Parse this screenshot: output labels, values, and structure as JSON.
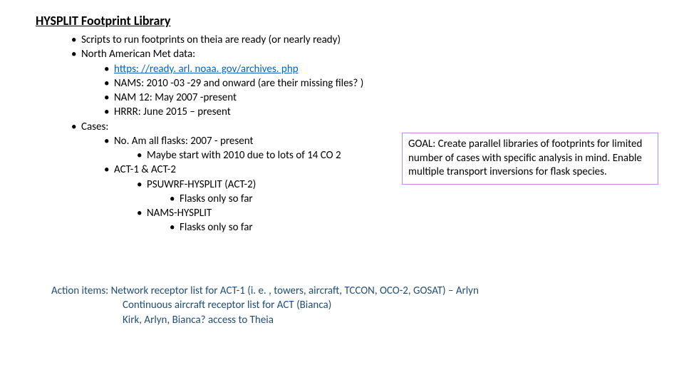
{
  "title": "HYSPLIT Footprint Library",
  "bullets": {
    "b1": "Scripts to run footprints on theia are ready (or nearly ready)",
    "b2": "North American Met data:",
    "b2a_url": "https: //ready. arl. noaa. gov/archives. php",
    "b2b": "NAMS: 2010 -03 -29 and onward (are their missing files? )",
    "b2c": "NAM 12: May 2007 -present",
    "b2d": "HRRR: June 2015 – present",
    "b3": "Cases:",
    "b3a": "No. Am all flasks: 2007 - present",
    "b3a1": "Maybe start with 2010 due to lots of 14 CO 2",
    "b3b": "ACT-1 & ACT-2",
    "b3b1": "PSUWRF-HYSPLIT (ACT-2)",
    "b3b1a": "Flasks only so far",
    "b3b2": "NAMS-HYSPLIT",
    "b3b2a": "Flasks only so far"
  },
  "goal": "GOAL:  Create parallel libraries of footprints for limited number of cases with specific analysis in mind.  Enable multiple transport inversions for flask species.",
  "action": {
    "line1": "Action items:  Network receptor list for ACT-1 (i. e. , towers, aircraft, TCCON, OCO-2, GOSAT) – Arlyn",
    "line2": "Continuous aircraft receptor list for ACT (Bianca)",
    "line3": "Kirk, Arlyn, Bianca? access to Theia"
  }
}
